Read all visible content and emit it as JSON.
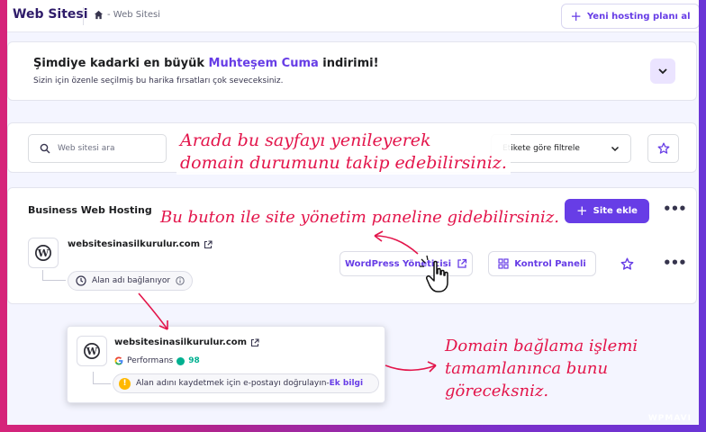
{
  "header": {
    "title": "Web Sitesi",
    "breadcrumb": "- Web Sitesi",
    "new_hosting_label": "Yeni hosting planı al"
  },
  "promo": {
    "headline_pre": "Şimdiye kadarki en büyük ",
    "headline_accent": "Muhteşem Cuma",
    "headline_post": " indirimi!",
    "subtitle": "Sizin için özenle seçilmiş bu harika fırsatları çok seveceksiniz."
  },
  "filters": {
    "search_placeholder": "Web sitesi ara",
    "tag_filter_label": "Etikete göre filtrele"
  },
  "sites_card": {
    "title": "Business Web Hosting",
    "add_site_label": "Site ekle",
    "site": {
      "domain": "websitesinasilkurulur.com",
      "status": "Alan adı bağlanıyor",
      "wp_admin_label": "WordPress Yöneticisi",
      "control_panel_label": "Kontrol Paneli"
    }
  },
  "popup": {
    "domain": "websitesinasilkurulur.com",
    "performance_label": "Performans",
    "performance_score": "98",
    "warning_text": "Alan adını kaydetmek için e-postayı doğrulayın",
    "warning_sep": " - ",
    "warning_link": "Ek bilgi"
  },
  "annotations": {
    "note1_line1": "Arada bu sayfayı yenileyerek",
    "note1_line2": "domain durumunu takip edebilirsiniz.",
    "note2": "Bu buton ile site yönetim paneline gidebilirsiniz.",
    "note3_line1": "Domain bağlama işlemi",
    "note3_line2": "tamamlanınca bunu",
    "note3_line3": "göreceksniz."
  },
  "watermark": "WPMAVI",
  "colors": {
    "accent": "#673de6",
    "annotation": "#e3154b",
    "warning": "#ffb800",
    "score": "#00b090"
  }
}
